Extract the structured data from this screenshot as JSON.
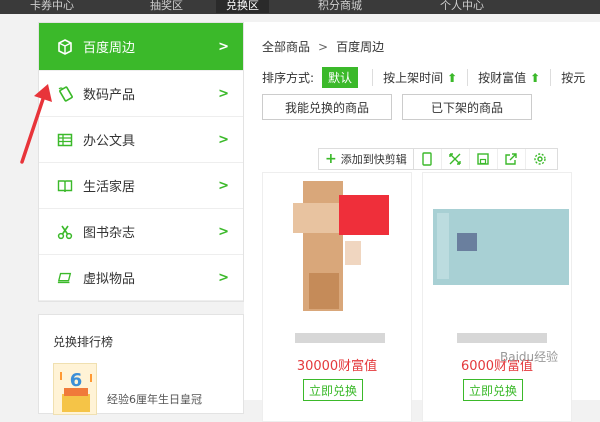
{
  "topnav": {
    "items": [
      "卡券中心",
      "抽奖区",
      "兑换区",
      "积分商城",
      "个人中心"
    ]
  },
  "sidebar": {
    "items": [
      {
        "label": "百度周边",
        "icon": "box-icon",
        "active": true
      },
      {
        "label": "数码产品",
        "icon": "phone-icon",
        "active": false
      },
      {
        "label": "办公文具",
        "icon": "spreadsheet-icon",
        "active": false
      },
      {
        "label": "生活家居",
        "icon": "book-open-icon",
        "active": false
      },
      {
        "label": "图书杂志",
        "icon": "scissors-icon",
        "active": false
      },
      {
        "label": "虚拟物品",
        "icon": "laptop-icon",
        "active": false
      }
    ]
  },
  "rank": {
    "title": "兑换排行榜",
    "item_text": "经验6厘年生日皇冠"
  },
  "breadcrumb": {
    "root": "全部商品",
    "separator": ">",
    "current": "百度周边"
  },
  "sort": {
    "label": "排序方式:",
    "default": "默认",
    "options": [
      "按上架时间",
      "按财富值",
      "按元"
    ]
  },
  "filters": {
    "can_redeem": "我能兑换的商品",
    "offline": "已下架的商品"
  },
  "toolbar": {
    "add_label": "添加到快剪辑"
  },
  "products": [
    {
      "price": "30000财富值",
      "redeem": "立即兑换"
    },
    {
      "price": "6000财富值",
      "redeem": "立即兑换"
    }
  ],
  "watermark": "Baidu经验",
  "colors": {
    "accent": "#3bb92a",
    "price": "#e4393c",
    "arrow": "#e8343a"
  }
}
